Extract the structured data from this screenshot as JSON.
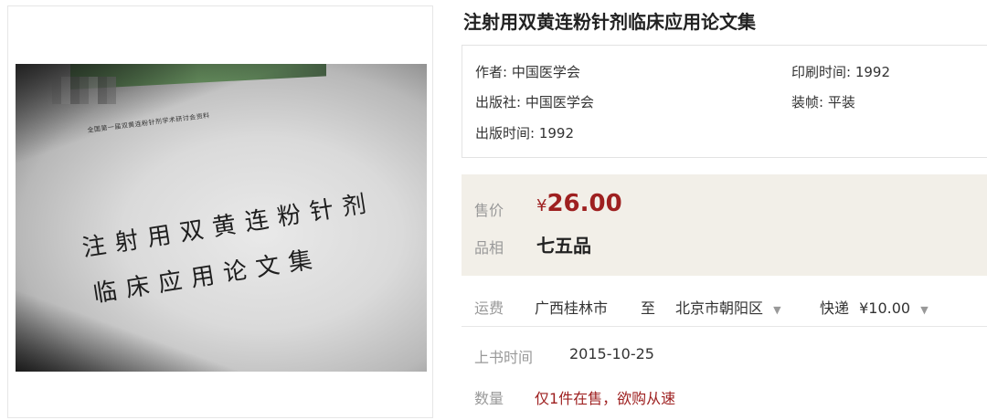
{
  "product": {
    "title": "注射用双黄连粉针剂临床应用论文集",
    "image": {
      "cover_subtitle": "全国第一届双黄连粉针剂学术研讨会资料",
      "cover_title_line1": "注射用双黄连粉针剂",
      "cover_title_line2": "临床应用论文集"
    },
    "meta": {
      "author": "作者: 中国医学会",
      "publisher": "出版社: 中国医学会",
      "publish_date": "出版时间: 1992",
      "print_date": "印刷时间: 1992",
      "binding": "装帧: 平装"
    },
    "pricing": {
      "price_label": "售价",
      "currency": "¥",
      "price": "26.00",
      "condition_label": "品相",
      "condition": "七五品",
      "price_color": "#9e2020"
    },
    "shipping": {
      "label": "运费",
      "origin": "广西桂林市",
      "to": "至",
      "destination": "北京市朝阳区",
      "method": "快递",
      "fee": "¥10.00"
    },
    "listing": {
      "date_label": "上书时间",
      "date": "2015-10-25",
      "quantity_label": "数量",
      "quantity_text": "仅1件在售，欲购从速"
    }
  }
}
